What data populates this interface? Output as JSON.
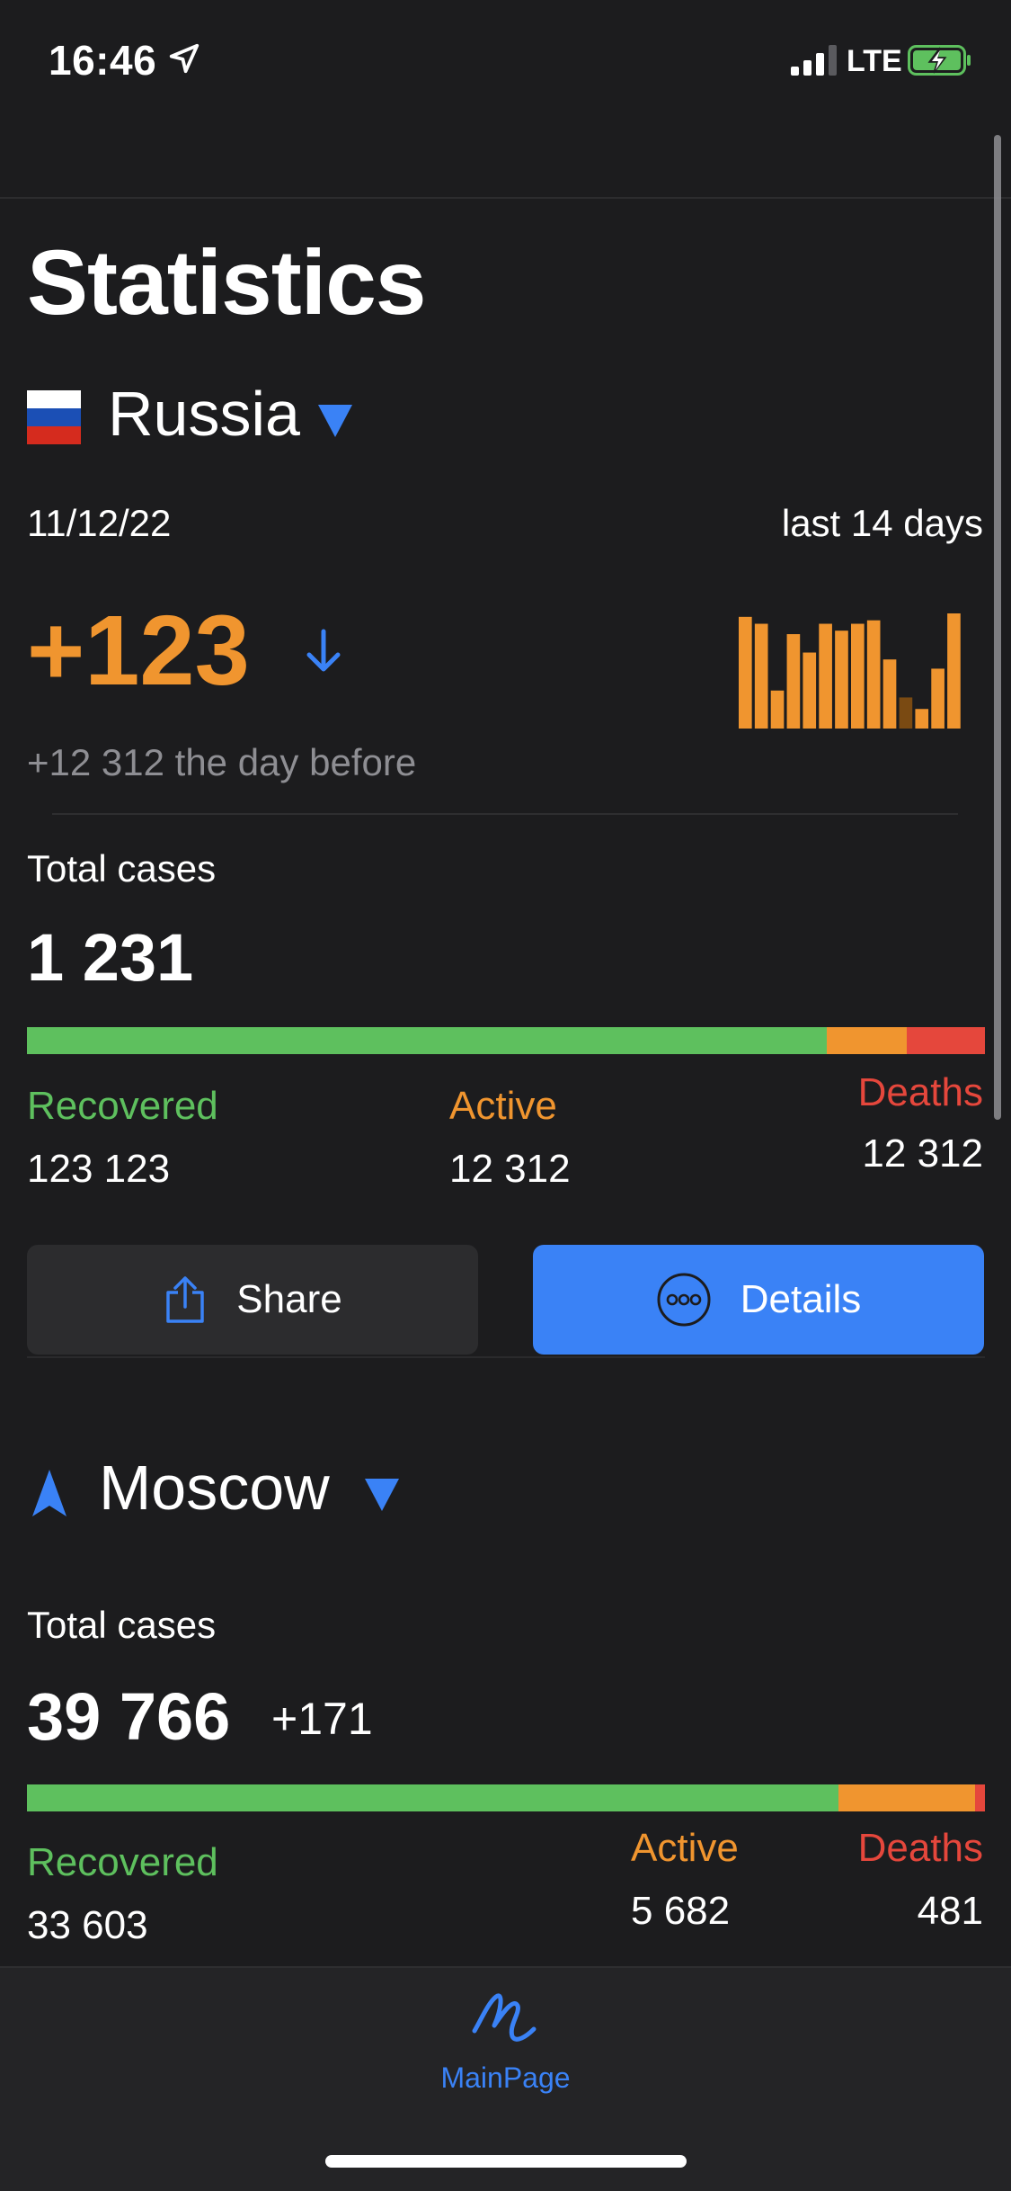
{
  "status_bar": {
    "time": "16:46",
    "network": "LTE",
    "icons": [
      "location-arrow-icon",
      "signal-icon",
      "battery-charging-icon"
    ]
  },
  "page": {
    "title": "Statistics"
  },
  "country": {
    "name": "Russia",
    "flag_colors": [
      "#ffffff",
      "#1b4fb5",
      "#d52b1e"
    ],
    "date": "11/12/22",
    "period_label": "last 14 days",
    "new_cases": "+123",
    "trend": "down",
    "day_before": "+12 312 the day before",
    "sparkline_values": [
      97,
      91,
      33,
      82,
      66,
      91,
      85,
      91,
      94,
      60,
      27,
      17,
      52,
      100
    ],
    "sparkline_highlight_index": 10,
    "total_label": "Total cases",
    "total_value": "1 231",
    "bar_fractions": {
      "recovered": 0.835,
      "active": 0.083,
      "deaths": 0.082
    },
    "recovered_label": "Recovered",
    "recovered_value": "123 123",
    "active_label": "Active",
    "active_value": "12 312",
    "deaths_label": "Deaths",
    "deaths_value": "12 312"
  },
  "actions": {
    "share_label": "Share",
    "details_label": "Details"
  },
  "city": {
    "name": "Moscow",
    "total_label": "Total cases",
    "total_value": "39 766",
    "total_delta": "+171",
    "bar_fractions": {
      "recovered": 0.847,
      "active": 0.143,
      "deaths": 0.01
    },
    "recovered_label": "Recovered",
    "recovered_value": "33 603",
    "active_label": "Active",
    "active_value": "5 682",
    "deaths_label": "Deaths",
    "deaths_value": "481"
  },
  "tabbar": {
    "items": [
      {
        "label": "MainPage",
        "icon": "scribble-icon",
        "selected": true
      }
    ]
  },
  "colors": {
    "accent": "#3a82f6",
    "recovered": "#5ec05e",
    "active": "#f0952f",
    "deaths": "#e5473c",
    "background": "#1c1c1e"
  }
}
